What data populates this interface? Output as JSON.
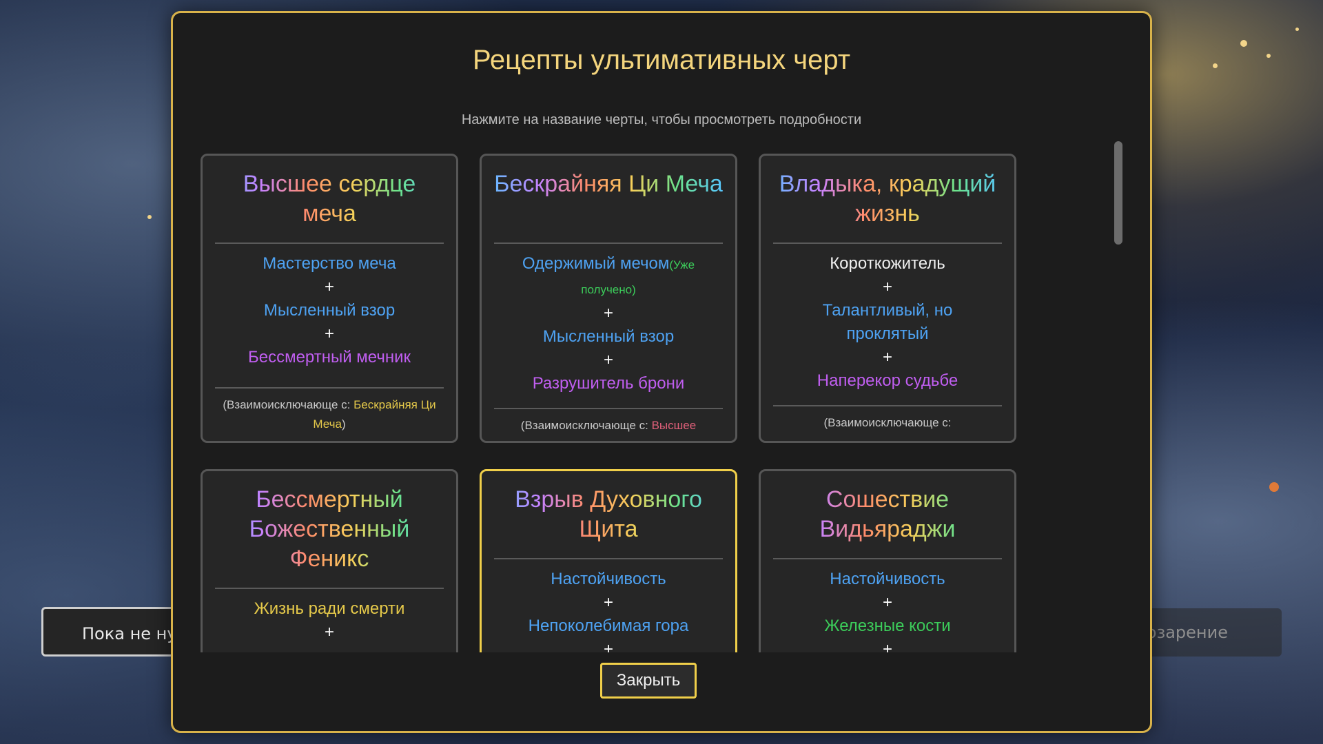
{
  "background": {
    "left_button": "Пока не нужно",
    "right_button": "ть озарение"
  },
  "modal": {
    "title": "Рецепты ультимативных черт",
    "subtitle": "Нажмите на название черты, чтобы просмотреть подробности",
    "close_label": "Закрыть"
  },
  "cards": [
    {
      "title": "Высшее сердце меча",
      "ingredients": [
        "Мастерство меча",
        "Мысленный взор",
        "Бессмертный мечник"
      ],
      "exclusive_prefix": "(Взаимоисключающе с: ",
      "exclusive_name": "Бескрайняя Ци Меча",
      "exclusive_suffix": ")"
    },
    {
      "title": "Бескрайняя Ци Меча",
      "ingredients": [
        "Одержимый мечом",
        "Мысленный взор",
        "Разрушитель брони"
      ],
      "obtained_note": "(Уже получено)",
      "exclusive_prefix": "(Взаимоисключающе с: ",
      "exclusive_name": "Высшее"
    },
    {
      "title": "Владыка, крадущий жизнь",
      "ingredients": [
        "Короткожитель",
        "Талантливый, но проклятый",
        "Наперекор судьбе"
      ],
      "exclusive_prefix": "(Взаимоисключающе с:"
    },
    {
      "title": "Бессмертный Божественный Феникс",
      "ingredients": [
        "Жизнь ради смерти"
      ]
    },
    {
      "title": "Взрыв Духовного Щита",
      "ingredients": [
        "Настойчивость",
        "Непоколебимая гора"
      ]
    },
    {
      "title": "Сошествие Видьяраджи",
      "ingredients": [
        "Настойчивость",
        "Железные кости"
      ]
    }
  ],
  "plus_sign": "+",
  "colors": {
    "accent": "#d8b24a",
    "ingredient_blue": "#4ea2f2",
    "ingredient_purple": "#c05ef0",
    "ingredient_yellow": "#e5c94a",
    "ingredient_green": "#3ccc5a"
  }
}
